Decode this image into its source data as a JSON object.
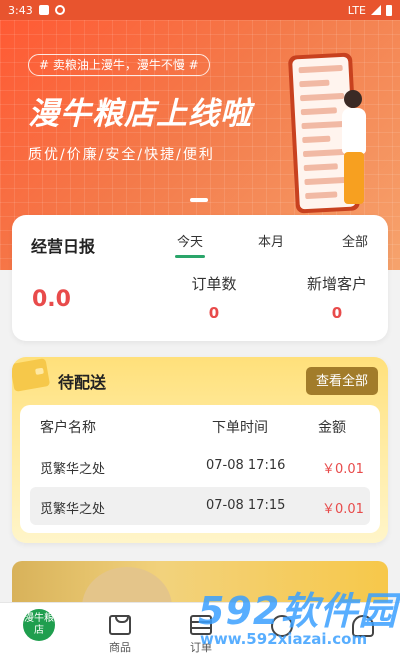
{
  "status_bar": {
    "time": "3:43",
    "network": "LTE"
  },
  "banner": {
    "tag": "# 卖粮油上漫牛，漫牛不慢 #",
    "headline": "漫牛粮店上线啦",
    "subline": "质优/价廉/安全/快捷/便利"
  },
  "stats": {
    "title": "经营日报",
    "tabs": [
      "今天",
      "本月",
      "全部"
    ],
    "active_tab": "今天",
    "amount": "0.0",
    "orders_label": "订单数",
    "orders_value": "0",
    "new_customers_label": "新增客户",
    "new_customers_value": "0"
  },
  "pending": {
    "title": "待配送",
    "view_all": "查看全部",
    "headers": [
      "客户名称",
      "下单时间",
      "金额"
    ],
    "rows": [
      {
        "customer": "觅繁华之处",
        "time": "07-08 17:16",
        "amount": "￥0.01"
      },
      {
        "customer": "觅繁华之处",
        "time": "07-08 17:15",
        "amount": "￥0.01"
      }
    ]
  },
  "bottom_nav": {
    "logo_text": "漫牛粮店",
    "items": [
      "商品",
      "订单"
    ]
  },
  "watermark": {
    "brand": "592软件园",
    "url": "www.592xiazai.com"
  },
  "colors": {
    "accent_green": "#2aa56a",
    "banner_orange": "#ff5a34",
    "price_red": "#e84b4b",
    "pending_yellow": "#ffe07a",
    "button_brown": "#a27c2a"
  }
}
